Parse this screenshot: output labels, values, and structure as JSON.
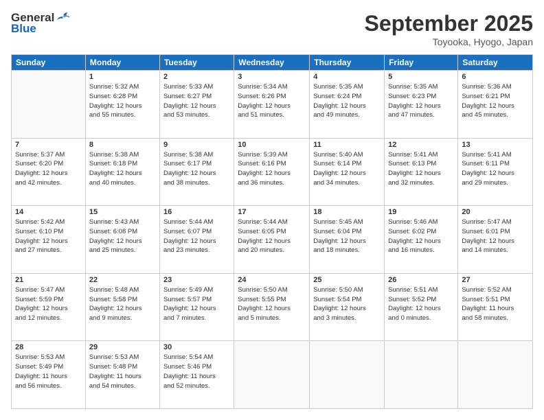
{
  "header": {
    "logo_general": "General",
    "logo_blue": "Blue",
    "month_title": "September 2025",
    "location": "Toyooka, Hyogo, Japan"
  },
  "weekdays": [
    "Sunday",
    "Monday",
    "Tuesday",
    "Wednesday",
    "Thursday",
    "Friday",
    "Saturday"
  ],
  "weeks": [
    [
      {
        "day": "",
        "info": ""
      },
      {
        "day": "1",
        "info": "Sunrise: 5:32 AM\nSunset: 6:28 PM\nDaylight: 12 hours\nand 55 minutes."
      },
      {
        "day": "2",
        "info": "Sunrise: 5:33 AM\nSunset: 6:27 PM\nDaylight: 12 hours\nand 53 minutes."
      },
      {
        "day": "3",
        "info": "Sunrise: 5:34 AM\nSunset: 6:26 PM\nDaylight: 12 hours\nand 51 minutes."
      },
      {
        "day": "4",
        "info": "Sunrise: 5:35 AM\nSunset: 6:24 PM\nDaylight: 12 hours\nand 49 minutes."
      },
      {
        "day": "5",
        "info": "Sunrise: 5:35 AM\nSunset: 6:23 PM\nDaylight: 12 hours\nand 47 minutes."
      },
      {
        "day": "6",
        "info": "Sunrise: 5:36 AM\nSunset: 6:21 PM\nDaylight: 12 hours\nand 45 minutes."
      }
    ],
    [
      {
        "day": "7",
        "info": "Sunrise: 5:37 AM\nSunset: 6:20 PM\nDaylight: 12 hours\nand 42 minutes."
      },
      {
        "day": "8",
        "info": "Sunrise: 5:38 AM\nSunset: 6:18 PM\nDaylight: 12 hours\nand 40 minutes."
      },
      {
        "day": "9",
        "info": "Sunrise: 5:38 AM\nSunset: 6:17 PM\nDaylight: 12 hours\nand 38 minutes."
      },
      {
        "day": "10",
        "info": "Sunrise: 5:39 AM\nSunset: 6:16 PM\nDaylight: 12 hours\nand 36 minutes."
      },
      {
        "day": "11",
        "info": "Sunrise: 5:40 AM\nSunset: 6:14 PM\nDaylight: 12 hours\nand 34 minutes."
      },
      {
        "day": "12",
        "info": "Sunrise: 5:41 AM\nSunset: 6:13 PM\nDaylight: 12 hours\nand 32 minutes."
      },
      {
        "day": "13",
        "info": "Sunrise: 5:41 AM\nSunset: 6:11 PM\nDaylight: 12 hours\nand 29 minutes."
      }
    ],
    [
      {
        "day": "14",
        "info": "Sunrise: 5:42 AM\nSunset: 6:10 PM\nDaylight: 12 hours\nand 27 minutes."
      },
      {
        "day": "15",
        "info": "Sunrise: 5:43 AM\nSunset: 6:08 PM\nDaylight: 12 hours\nand 25 minutes."
      },
      {
        "day": "16",
        "info": "Sunrise: 5:44 AM\nSunset: 6:07 PM\nDaylight: 12 hours\nand 23 minutes."
      },
      {
        "day": "17",
        "info": "Sunrise: 5:44 AM\nSunset: 6:05 PM\nDaylight: 12 hours\nand 20 minutes."
      },
      {
        "day": "18",
        "info": "Sunrise: 5:45 AM\nSunset: 6:04 PM\nDaylight: 12 hours\nand 18 minutes."
      },
      {
        "day": "19",
        "info": "Sunrise: 5:46 AM\nSunset: 6:02 PM\nDaylight: 12 hours\nand 16 minutes."
      },
      {
        "day": "20",
        "info": "Sunrise: 5:47 AM\nSunset: 6:01 PM\nDaylight: 12 hours\nand 14 minutes."
      }
    ],
    [
      {
        "day": "21",
        "info": "Sunrise: 5:47 AM\nSunset: 5:59 PM\nDaylight: 12 hours\nand 12 minutes."
      },
      {
        "day": "22",
        "info": "Sunrise: 5:48 AM\nSunset: 5:58 PM\nDaylight: 12 hours\nand 9 minutes."
      },
      {
        "day": "23",
        "info": "Sunrise: 5:49 AM\nSunset: 5:57 PM\nDaylight: 12 hours\nand 7 minutes."
      },
      {
        "day": "24",
        "info": "Sunrise: 5:50 AM\nSunset: 5:55 PM\nDaylight: 12 hours\nand 5 minutes."
      },
      {
        "day": "25",
        "info": "Sunrise: 5:50 AM\nSunset: 5:54 PM\nDaylight: 12 hours\nand 3 minutes."
      },
      {
        "day": "26",
        "info": "Sunrise: 5:51 AM\nSunset: 5:52 PM\nDaylight: 12 hours\nand 0 minutes."
      },
      {
        "day": "27",
        "info": "Sunrise: 5:52 AM\nSunset: 5:51 PM\nDaylight: 11 hours\nand 58 minutes."
      }
    ],
    [
      {
        "day": "28",
        "info": "Sunrise: 5:53 AM\nSunset: 5:49 PM\nDaylight: 11 hours\nand 56 minutes."
      },
      {
        "day": "29",
        "info": "Sunrise: 5:53 AM\nSunset: 5:48 PM\nDaylight: 11 hours\nand 54 minutes."
      },
      {
        "day": "30",
        "info": "Sunrise: 5:54 AM\nSunset: 5:46 PM\nDaylight: 11 hours\nand 52 minutes."
      },
      {
        "day": "",
        "info": ""
      },
      {
        "day": "",
        "info": ""
      },
      {
        "day": "",
        "info": ""
      },
      {
        "day": "",
        "info": ""
      }
    ]
  ]
}
